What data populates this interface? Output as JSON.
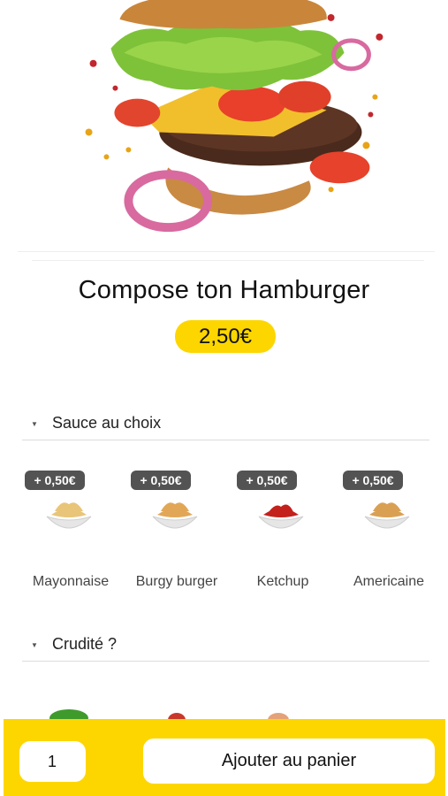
{
  "product": {
    "title": "Compose ton Hamburger",
    "price": "2,50€",
    "image_alt": "burger-illustration"
  },
  "sections": [
    {
      "label": "Sauce au choix",
      "options": [
        {
          "label": "Mayonnaise",
          "extra": "+ 0,50€",
          "sauce_color": "#e8c579"
        },
        {
          "label": "Burgy burger",
          "extra": "+ 0,50€",
          "sauce_color": "#e2a756"
        },
        {
          "label": "Ketchup",
          "extra": "+ 0,50€",
          "sauce_color": "#c4201c"
        },
        {
          "label": "Americaine",
          "extra": "+ 0,50€",
          "sauce_color": "#d9a054"
        }
      ]
    },
    {
      "label": "Crudité ?"
    }
  ],
  "cart": {
    "quantity": "1",
    "add_label": "Ajouter au panier"
  },
  "colors": {
    "accent": "#fdd600",
    "badge": "#535353"
  }
}
